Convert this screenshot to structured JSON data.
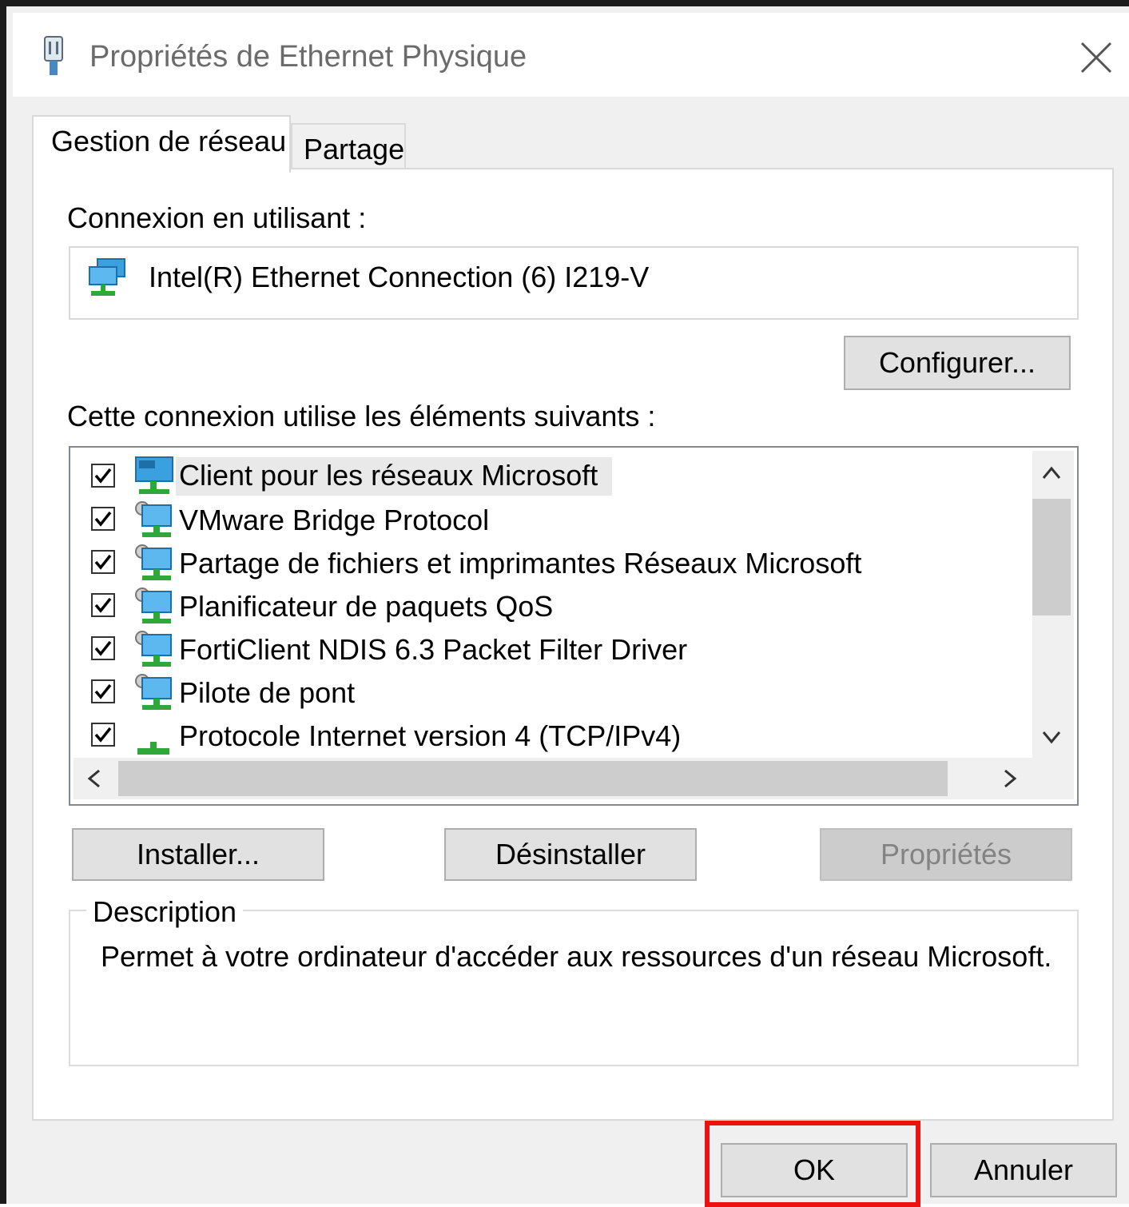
{
  "window": {
    "title": "Propriétés de Ethernet Physique",
    "icons": {
      "title": "ethernet-plug-icon",
      "close": "close-icon"
    }
  },
  "tabs": [
    {
      "label": "Gestion de réseau",
      "active": true
    },
    {
      "label": "Partage",
      "active": false
    }
  ],
  "connection": {
    "label": "Connexion en utilisant :",
    "adapter_name": "Intel(R) Ethernet Connection (6) I219-V",
    "adapter_icon": "network-adapter-icon",
    "configure_button": "Configurer..."
  },
  "components": {
    "label": "Cette connexion utilise les éléments suivants :",
    "items": [
      {
        "label": "Client pour les réseaux Microsoft",
        "checked": true,
        "selected": true,
        "icon": "network-client-icon"
      },
      {
        "label": "VMware Bridge Protocol",
        "checked": true,
        "selected": false,
        "icon": "network-service-icon"
      },
      {
        "label": "Partage de fichiers et imprimantes Réseaux Microsoft",
        "checked": true,
        "selected": false,
        "icon": "network-service-icon"
      },
      {
        "label": "Planificateur de paquets QoS",
        "checked": true,
        "selected": false,
        "icon": "network-service-icon"
      },
      {
        "label": "FortiClient NDIS 6.3 Packet Filter Driver",
        "checked": true,
        "selected": false,
        "icon": "network-service-icon"
      },
      {
        "label": "Pilote de pont",
        "checked": true,
        "selected": false,
        "icon": "network-service-icon"
      },
      {
        "label": "Protocole Internet version 4 (TCP/IPv4)",
        "checked": true,
        "selected": false,
        "icon": "network-protocol-icon"
      }
    ],
    "scroll_icons": {
      "up": "chevron-up-icon",
      "down": "chevron-down-icon",
      "left": "chevron-left-icon",
      "right": "chevron-right-icon"
    }
  },
  "buttons": {
    "install": "Installer...",
    "uninstall": "Désinstaller",
    "properties": "Propriétés",
    "ok": "OK",
    "cancel": "Annuler"
  },
  "description": {
    "legend": "Description",
    "text": "Permet à votre ordinateur d'accéder aux ressources d'un réseau Microsoft."
  },
  "colors": {
    "highlight": "#ee1111",
    "icon_blue": "#3aa0e0",
    "icon_green": "#2fa83a"
  }
}
